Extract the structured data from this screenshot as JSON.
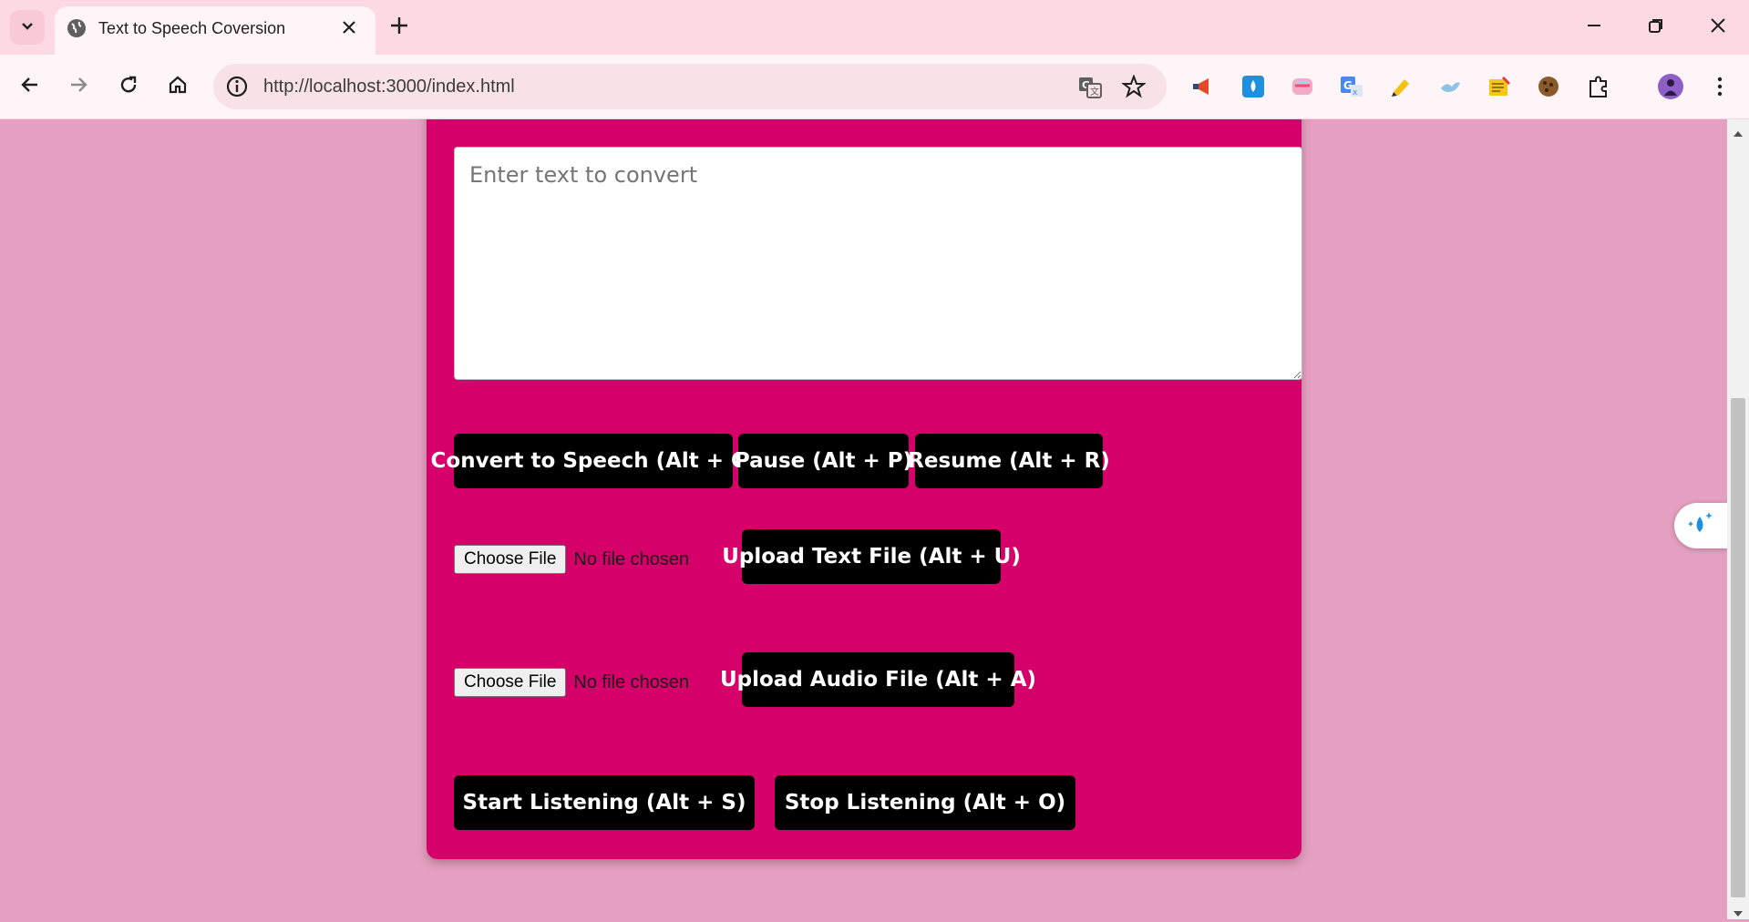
{
  "browser": {
    "tab_title": "Text to Speech Coversion",
    "url": "http://localhost:3000/index.html"
  },
  "icons": {
    "tab_dropdown": "chevron-down-icon",
    "favicon": "globe-icon",
    "close": "close-icon",
    "new_tab": "plus-icon",
    "back": "arrow-left-icon",
    "forward": "arrow-right-icon",
    "reload": "reload-icon",
    "home": "home-icon",
    "site_info": "info-icon",
    "translate": "translate-icon",
    "bookmark": "star-icon",
    "extensions": "puzzle-icon",
    "menu": "kebab-menu-icon"
  },
  "page": {
    "textarea_placeholder": "Enter text to convert",
    "buttons": {
      "convert": "Convert to Speech (Alt + C)",
      "pause": "Pause (Alt + P)",
      "resume": "Resume (Alt + R)",
      "upload_text": "Upload Text File (Alt + U)",
      "upload_audio": "Upload Audio File (Alt + A)",
      "start_listening": "Start Listening (Alt + S)",
      "stop_listening": "Stop Listening (Alt + O)"
    },
    "file_input": {
      "choose_label": "Choose File",
      "status": "No file chosen"
    }
  },
  "colors": {
    "page_bg": "#e59fc0",
    "card_bg": "#d6006a",
    "button_bg": "#000000",
    "chrome_bg": "#fdd9e1"
  }
}
